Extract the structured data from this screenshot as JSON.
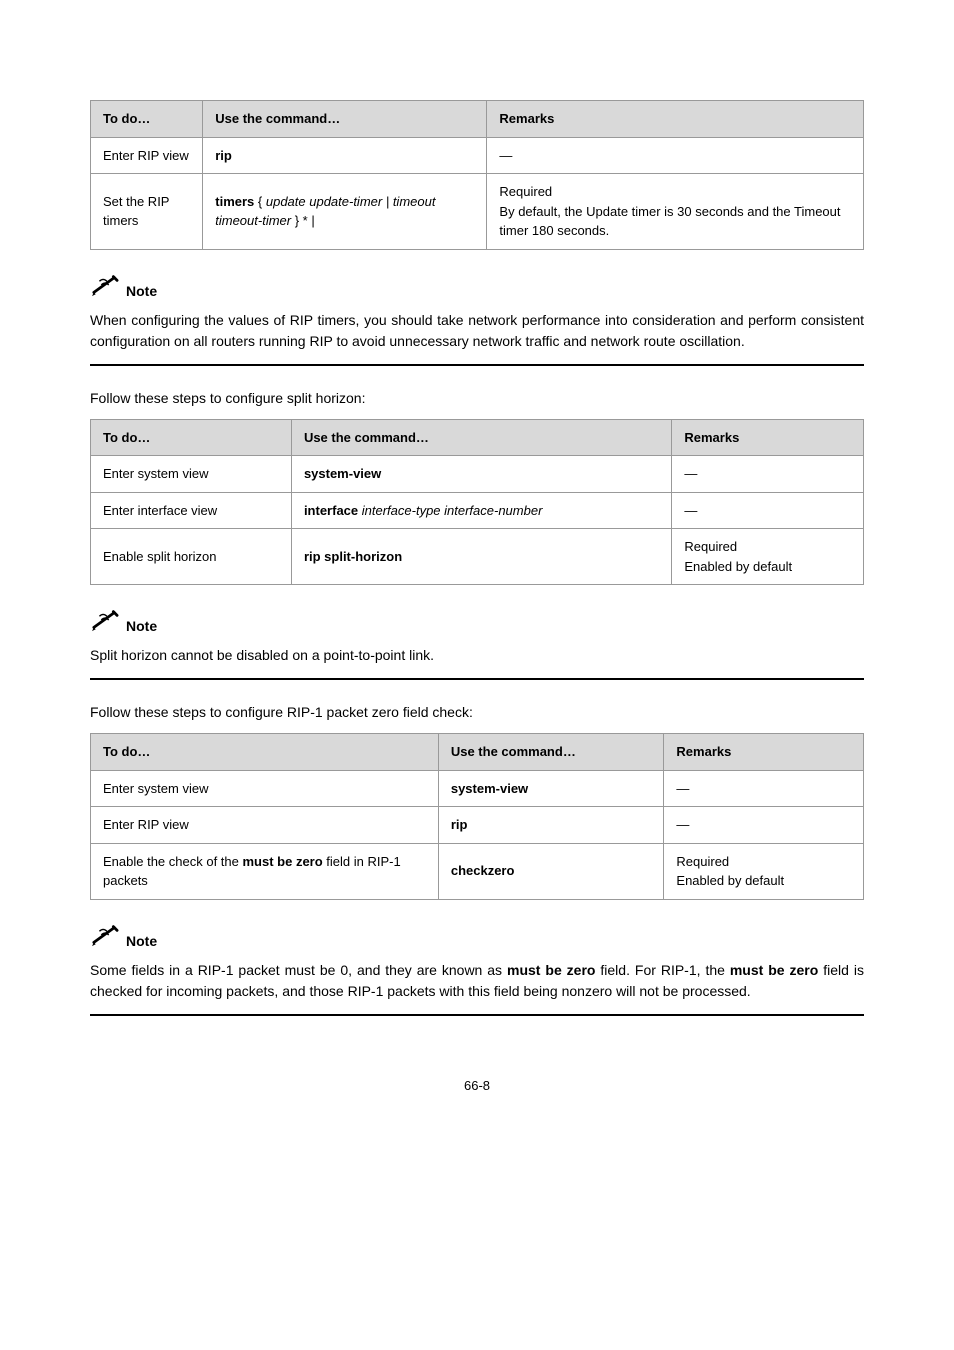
{
  "table1": {
    "headers": [
      "To do…",
      "Use the command…",
      "Remarks"
    ],
    "rows": [
      {
        "c0": "Enter RIP view",
        "c1": "rip",
        "c2": "—"
      },
      {
        "c0": "Set the RIP timers",
        "c1_pre": "timers",
        "c1_opts": "update update-timer | timeout timeout-timer",
        "c2": "Required\nBy default, the Update timer is 30 seconds and the Timeout timer 180 seconds."
      }
    ]
  },
  "noteLabel": "Note",
  "note1": {
    "text": "When configuring the values of RIP timers, you should take network performance into consideration and perform consistent configuration on all routers running RIP to avoid unnecessary network traffic and network route oscillation."
  },
  "lead2": "Follow these steps to configure split horizon:",
  "table2": {
    "headers": [
      "To do…",
      "Use the command…",
      "Remarks"
    ],
    "rows": [
      {
        "c0": "Enter system view",
        "c1": "system-view",
        "c2": "—"
      },
      {
        "c0": "Enter interface view",
        "c1a": "interface",
        "c1b": "interface-type interface-number",
        "c2": "—"
      },
      {
        "c0": "Enable split horizon",
        "c1": "rip split-horizon",
        "c2": "Required\nEnabled by default"
      }
    ]
  },
  "note2": {
    "text": "Split horizon cannot be disabled on a point-to-point link."
  },
  "lead3": "Follow these steps to configure RIP-1 packet zero field check:",
  "table3": {
    "headers": [
      "To do…",
      "Use the command…",
      "Remarks"
    ],
    "rows": [
      {
        "c0pre": "Enter system view",
        "c1": "system-view",
        "c2": "—"
      },
      {
        "c0pre": "Enter RIP view",
        "c1": "rip",
        "c2": "—"
      },
      {
        "c0pre": "Enable the check of the ",
        "c0mbz": "must be zero",
        "c0post": " field in RIP-1 packets",
        "c1": "checkzero",
        "c2": "Required\nEnabled by default"
      }
    ]
  },
  "note3": {
    "pre": "Some fields in a RIP-1 packet must be 0, and they are known as ",
    "mbz1": "must be zero",
    "mid": " field. For RIP-1, the ",
    "mbz2": "must be zero",
    "post": " field is checked for incoming packets, and those RIP-1 packets with this field being nonzero will not be processed."
  },
  "pageNum": "66-8"
}
